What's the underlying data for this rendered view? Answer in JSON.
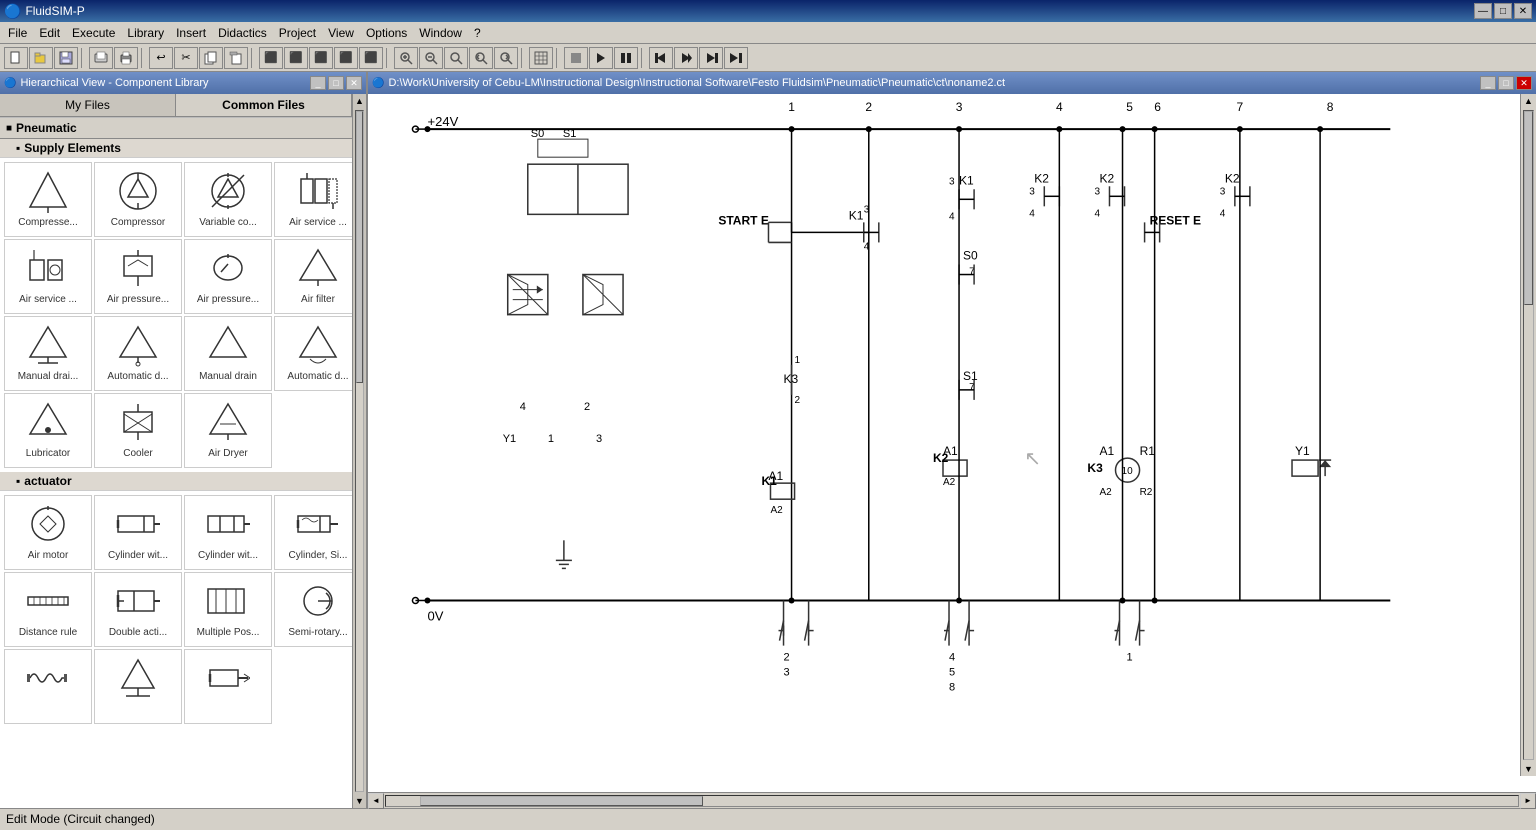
{
  "app": {
    "title": "FluidSIM-P",
    "icon": "fluidsim-icon"
  },
  "titlebar": {
    "minimize_label": "—",
    "maximize_label": "□",
    "close_label": "✕"
  },
  "menu": {
    "items": [
      "File",
      "Edit",
      "Execute",
      "Library",
      "Insert",
      "Didactics",
      "Project",
      "View",
      "Options",
      "Window",
      "?"
    ]
  },
  "toolbar": {
    "buttons": [
      {
        "name": "new",
        "icon": "📄"
      },
      {
        "name": "open",
        "icon": "📂"
      },
      {
        "name": "save",
        "icon": "💾"
      },
      {
        "name": "print-preview",
        "icon": "🖨"
      },
      {
        "name": "print",
        "icon": "🖨"
      },
      {
        "name": "undo",
        "icon": "↩"
      },
      {
        "name": "cut",
        "icon": "✂"
      },
      {
        "name": "copy",
        "icon": "📋"
      },
      {
        "name": "paste",
        "icon": "📋"
      },
      {
        "name": "align-left",
        "icon": "⬛"
      },
      {
        "name": "align-center",
        "icon": "⬛"
      },
      {
        "name": "align-right",
        "icon": "⬛"
      },
      {
        "name": "align-top",
        "icon": "⬛"
      },
      {
        "name": "align-bottom",
        "icon": "⬛"
      },
      {
        "name": "zoom-in",
        "icon": "+"
      },
      {
        "name": "zoom-out",
        "icon": "−"
      },
      {
        "name": "zoom-fit",
        "icon": "⊞"
      },
      {
        "name": "zoom-prev",
        "icon": "←"
      },
      {
        "name": "zoom-next",
        "icon": "→"
      },
      {
        "name": "table",
        "icon": "⊞"
      },
      {
        "name": "play",
        "icon": "▶"
      },
      {
        "name": "pause",
        "icon": "⏸"
      },
      {
        "name": "stop",
        "icon": "⏹"
      },
      {
        "name": "step-back",
        "icon": "⏮"
      },
      {
        "name": "step-forward",
        "icon": "⏭"
      },
      {
        "name": "fast-forward",
        "icon": "⏩"
      }
    ]
  },
  "library": {
    "title": "Hierarchical View - Component Library",
    "tabs": [
      {
        "id": "my-files",
        "label": "My Files",
        "active": false
      },
      {
        "id": "common-files",
        "label": "Common Files",
        "active": true
      }
    ],
    "categories": [
      {
        "id": "pneumatic",
        "label": "Pneumatic",
        "expanded": true,
        "subcategories": [
          {
            "id": "supply-elements",
            "label": "Supply Elements",
            "expanded": true,
            "components": [
              {
                "id": "compressor-fixed",
                "label": "Compresse...",
                "shape": "triangle"
              },
              {
                "id": "compressor",
                "label": "Compressor",
                "shape": "circle"
              },
              {
                "id": "variable-compressor",
                "label": "Variable co...",
                "shape": "circle-arrow"
              },
              {
                "id": "air-service-unit",
                "label": "Air service ...",
                "shape": "service-unit"
              },
              {
                "id": "air-service-2",
                "label": "Air service ...",
                "shape": "service-2"
              },
              {
                "id": "air-pressure-switch",
                "label": "Air pressure...",
                "shape": "pressure-switch"
              },
              {
                "id": "air-pressure-gauge",
                "label": "Air pressure...",
                "shape": "gauge"
              },
              {
                "id": "air-filter",
                "label": "Air filter",
                "shape": "diamond"
              },
              {
                "id": "manual-drain",
                "label": "Manual drai...",
                "shape": "diamond"
              },
              {
                "id": "automatic-drain",
                "label": "Automatic d...",
                "shape": "diamond-auto"
              },
              {
                "id": "manual-drain-2",
                "label": "Manual drain",
                "shape": "diamond"
              },
              {
                "id": "automatic-drain-2",
                "label": "Automatic d...",
                "shape": "diamond"
              },
              {
                "id": "lubricator",
                "label": "Lubricator",
                "shape": "diamond"
              },
              {
                "id": "cooler",
                "label": "Cooler",
                "shape": "cooler"
              },
              {
                "id": "air-dryer",
                "label": "Air Dryer",
                "shape": "air-dryer"
              }
            ]
          },
          {
            "id": "actuator",
            "label": "actuator",
            "expanded": true,
            "components": [
              {
                "id": "air-motor",
                "label": "Air motor",
                "shape": "air-motor"
              },
              {
                "id": "cylinder-wit-1",
                "label": "Cylinder wit...",
                "shape": "cylinder-1"
              },
              {
                "id": "cylinder-wit-2",
                "label": "Cylinder wit...",
                "shape": "cylinder-2"
              },
              {
                "id": "cylinder-si",
                "label": "Cylinder, Si...",
                "shape": "cylinder-si"
              },
              {
                "id": "distance-rule",
                "label": "Distance rule",
                "shape": "distance"
              },
              {
                "id": "double-acti",
                "label": "Double acti...",
                "shape": "double-acti"
              },
              {
                "id": "multiple-pos",
                "label": "Multiple Pos...",
                "shape": "multiple-pos"
              },
              {
                "id": "semi-rotary",
                "label": "Semi-rotary...",
                "shape": "semi-rotary"
              },
              {
                "id": "item9",
                "label": "",
                "shape": "item9"
              },
              {
                "id": "item10",
                "label": "",
                "shape": "item10"
              },
              {
                "id": "item11",
                "label": "",
                "shape": "item11"
              }
            ]
          }
        ]
      }
    ]
  },
  "diagram": {
    "title": "D:\\Work\\University of Cebu-LM\\Instructional Design\\Instructional Software\\Festo Fluidsim\\Pneumatic\\Pneumatic\\ct\\noname2.ct",
    "labels": {
      "plus24v": "+24V",
      "zerov": "0V",
      "start": "START E",
      "reset": "RESET E",
      "k1": "K1",
      "k2": "K2",
      "k3": "K3",
      "s0": "S0",
      "s1": "S1",
      "r1": "R1",
      "r2": "R2",
      "y1_left": "Y1",
      "y1_right": "Y1",
      "col1": "1",
      "col2": "2",
      "col3": "3",
      "col4": "4",
      "col5": "5",
      "col6": "6",
      "col7": "7",
      "col8": "8"
    }
  },
  "status": {
    "text": "Edit Mode (Circuit changed)"
  }
}
